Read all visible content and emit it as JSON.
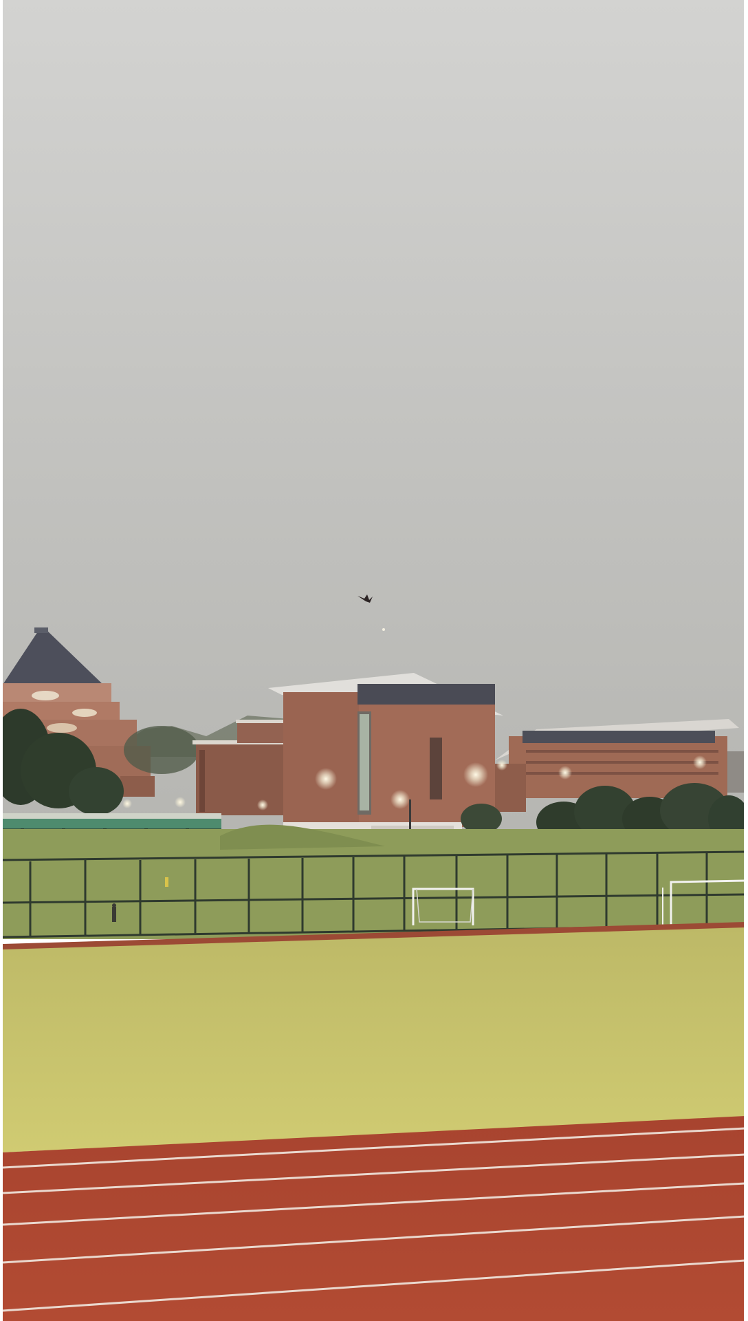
{
  "scene": {
    "subjects": [
      "sky",
      "bird",
      "domed-building",
      "brick-building",
      "long-building",
      "trees",
      "stadium-lights",
      "fence",
      "soccer-goals",
      "grass-field",
      "running-track"
    ],
    "colors": {
      "sky_top": "#cfcfcd",
      "sky_bottom": "#b9b9b6",
      "brick": "#a06a55",
      "brick_dark": "#7f5142",
      "roof": "#4e4e56",
      "trees": "#2e3b2a",
      "field": "#c8c46a",
      "field_far": "#8f9f5a",
      "track": "#b24a34",
      "track_line": "#e8d6cc"
    }
  }
}
